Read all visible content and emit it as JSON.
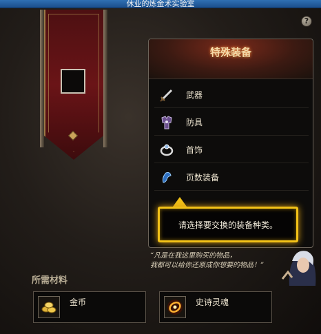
{
  "window": {
    "title": "休业的炼金术实验室"
  },
  "help": {
    "label": "?"
  },
  "panel": {
    "title": "特殊装备",
    "items": [
      {
        "label": "武器",
        "icon": "sword-icon"
      },
      {
        "label": "防具",
        "icon": "armor-icon"
      },
      {
        "label": "首饰",
        "icon": "ring-icon"
      },
      {
        "label": "页数装备",
        "icon": "crystal-icon"
      }
    ]
  },
  "tooltip": {
    "text": "请选择要交换的装备种类。"
  },
  "npc": {
    "quote_line1": "“凡是在我这里购买的物品，",
    "quote_line2": "我都可以给你还原成你想要的物品！”"
  },
  "materials": {
    "title": "所需材料",
    "items": [
      {
        "label": "金币",
        "icon": "gold-coins-icon"
      },
      {
        "label": "史诗灵魂",
        "icon": "epic-soul-icon"
      }
    ]
  },
  "colors": {
    "highlight": "#f2c218",
    "banner": "#6a1417",
    "title_glow": "#ff8a3a"
  }
}
